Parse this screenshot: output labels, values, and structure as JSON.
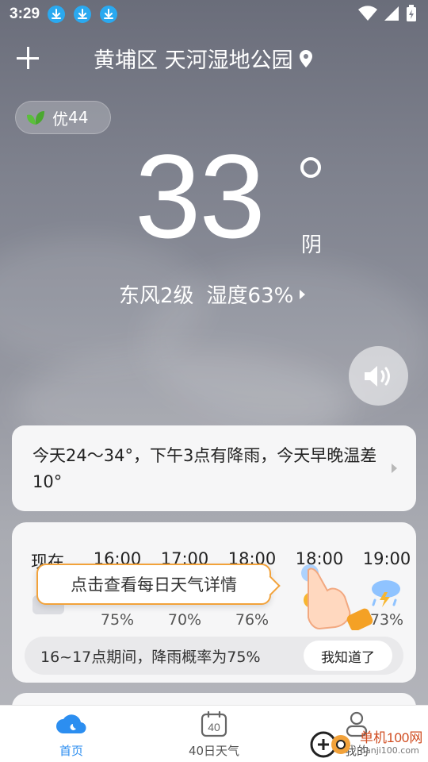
{
  "status_bar": {
    "time": "3:29",
    "download_icons": [
      "download-icon",
      "download-icon",
      "download-icon"
    ],
    "icons": [
      "wifi-icon",
      "signal-icon",
      "battery-icon"
    ]
  },
  "header": {
    "location": "黄埔区 天河湿地公园",
    "add_icon": "plus-icon",
    "location_icon": "map-pin-icon"
  },
  "aqi": {
    "label": "优",
    "value": "44",
    "color": "#5bbf3c"
  },
  "current": {
    "temperature": "33",
    "condition": "阴",
    "wind": "东风2级",
    "humidity": "湿度63%"
  },
  "summary": {
    "text": "今天24～34°，下午3点有降雨，今天早晚温差10°"
  },
  "hourly": {
    "hours": [
      {
        "time": "现在",
        "pct": ""
      },
      {
        "time": "16:00",
        "pct": "75%"
      },
      {
        "time": "17:00",
        "pct": "70%"
      },
      {
        "time": "18:00",
        "pct": "76%"
      },
      {
        "time": "18:00",
        "pct": ""
      },
      {
        "time": "19:00",
        "pct": "73%"
      }
    ],
    "tooltip": "点击查看每日天气详情",
    "rain_notice": "16~17点期间，降雨概率为75%",
    "got_it": "我知道了"
  },
  "bottom_nav": {
    "items": [
      {
        "label": "首页",
        "icon": "cloud-moon-icon",
        "active": true
      },
      {
        "label": "40日天气",
        "icon": "calendar-40-icon",
        "active": false
      },
      {
        "label": "我的",
        "icon": "profile-icon",
        "active": false
      }
    ],
    "calendar_number": "40",
    "accent": "#2c8ef0"
  },
  "watermark": {
    "name": "单机100网",
    "url": "danji100.com"
  }
}
